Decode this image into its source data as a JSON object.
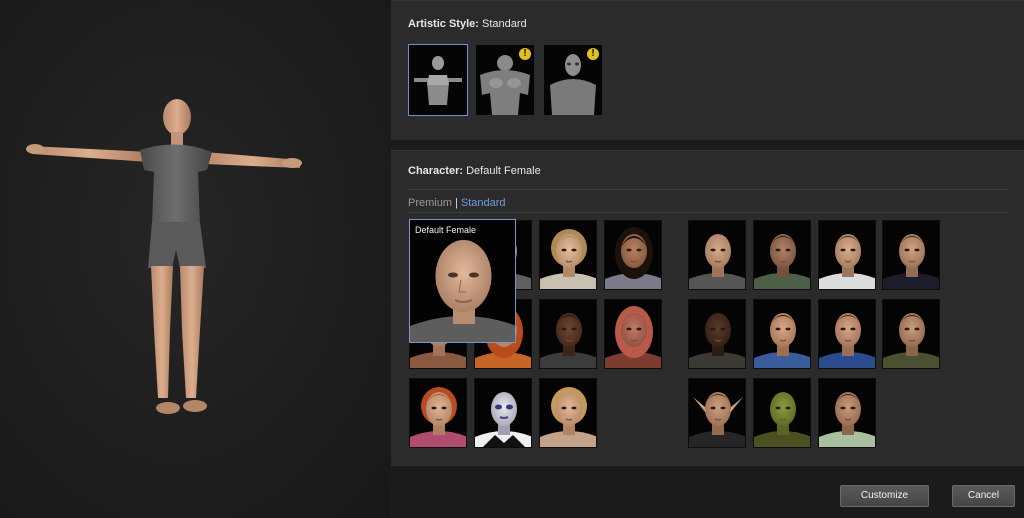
{
  "artistic_style": {
    "label": "Artistic Style:",
    "value": "Standard",
    "options": [
      {
        "name": "standard",
        "warning": false
      },
      {
        "name": "muscular-beast",
        "warning": true
      },
      {
        "name": "alien",
        "warning": true
      }
    ]
  },
  "character": {
    "label": "Character:",
    "value": "Default Female",
    "tabs": {
      "premium": "Premium",
      "separator": "|",
      "standard": "Standard",
      "active": "standard"
    },
    "preview_label": "Default Female"
  },
  "warning_glyph": "!",
  "buttons": {
    "customize": "Customize",
    "cancel": "Cancel"
  },
  "colors": {
    "accent": "#6f9be6",
    "selection_border": "#7b97c9",
    "warning": "#e0c21a"
  }
}
